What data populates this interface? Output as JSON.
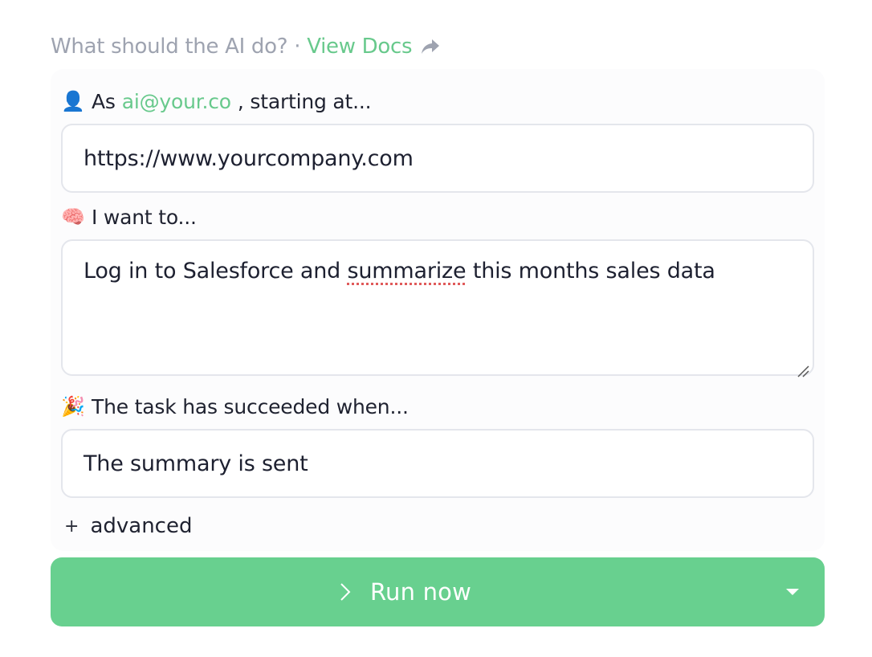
{
  "header": {
    "prompt": "What should the AI do?",
    "separator": "·",
    "docs_link": "View Docs",
    "share_icon": "share-arrow-icon"
  },
  "form": {
    "start": {
      "emoji": "👤",
      "prefix": "As",
      "email": "ai@your.co",
      "suffix": ", starting at...",
      "url_value": "https://www.yourcompany.com"
    },
    "task": {
      "emoji": "🧠",
      "label": "I want to...",
      "value_before": "Log in to Salesforce and ",
      "value_misspelled": "summarize",
      "value_after": " this months sales data"
    },
    "success": {
      "emoji": "🎉",
      "label": "The task has succeeded when...",
      "value": "The summary is sent"
    },
    "advanced": {
      "icon": "+",
      "label": "advanced"
    }
  },
  "run": {
    "label": "Run now",
    "icon": "chevron-right-icon",
    "dropdown_icon": "caret-down-icon"
  },
  "colors": {
    "accent": "#68c98c",
    "run_button": "#68d08f",
    "muted_text": "#9ea3b0",
    "text": "#1d2030",
    "border": "#e4e6ec"
  }
}
